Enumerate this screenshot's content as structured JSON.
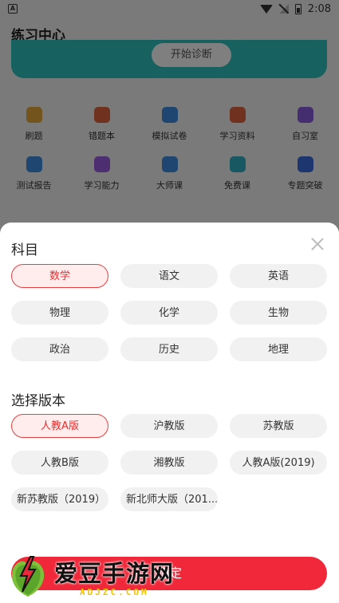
{
  "status_bar": {
    "time": "2:08",
    "app_badge": "A"
  },
  "background": {
    "header_title": "练习中心",
    "diagnose_button": "开始诊断",
    "grid": [
      [
        {
          "label": "刷题",
          "icon": "pencil-icon",
          "color": "#e8a83a"
        },
        {
          "label": "错题本",
          "icon": "notebook-icon",
          "color": "#e0643c"
        },
        {
          "label": "模拟试卷",
          "icon": "exam-paper-icon",
          "color": "#3c8de0"
        },
        {
          "label": "学习资料",
          "icon": "book-icon",
          "color": "#e0643c"
        },
        {
          "label": "自习室",
          "icon": "tv-icon",
          "color": "#8a5ce0"
        }
      ],
      [
        {
          "label": "测试报告",
          "icon": "report-icon",
          "color": "#3c8de0"
        },
        {
          "label": "学习能力",
          "icon": "lightbulb-icon",
          "color": "#9a5ce0"
        },
        {
          "label": "大师课",
          "icon": "thumbs-up-icon",
          "color": "#3c8de0"
        },
        {
          "label": "免费课",
          "icon": "video-icon",
          "color": "#2fb0c4"
        },
        {
          "label": "专题突破",
          "icon": "bookmark-icon",
          "color": "#3c6de0"
        }
      ]
    ]
  },
  "sheet": {
    "subject_title": "科目",
    "subjects": [
      {
        "label": "数学",
        "selected": true
      },
      {
        "label": "语文",
        "selected": false
      },
      {
        "label": "英语",
        "selected": false
      },
      {
        "label": "物理",
        "selected": false
      },
      {
        "label": "化学",
        "selected": false
      },
      {
        "label": "生物",
        "selected": false
      },
      {
        "label": "政治",
        "selected": false
      },
      {
        "label": "历史",
        "selected": false
      },
      {
        "label": "地理",
        "selected": false
      }
    ],
    "edition_title": "选择版本",
    "editions": [
      {
        "label": "人教A版",
        "selected": true
      },
      {
        "label": "沪教版",
        "selected": false
      },
      {
        "label": "苏教版",
        "selected": false
      },
      {
        "label": "人教B版",
        "selected": false
      },
      {
        "label": "湘教版",
        "selected": false
      },
      {
        "label": "人教A版(2019)",
        "selected": false
      },
      {
        "label": "新苏教版（2019）",
        "selected": false
      },
      {
        "label": "新北师大版（201...",
        "selected": false
      }
    ],
    "confirm_button": "确定"
  },
  "watermark": {
    "text": "爱豆手游网",
    "sub": "ADJZC.COM"
  },
  "colors": {
    "accent": "#f0283a",
    "banner": "#2fc4c1"
  }
}
